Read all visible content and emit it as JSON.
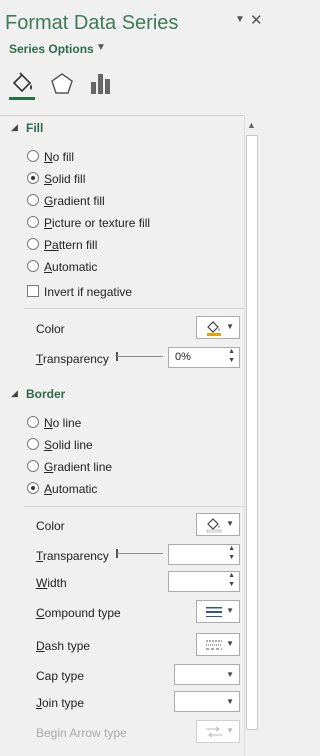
{
  "header": {
    "title": "Format Data Series",
    "series_options_label": "Series Options",
    "dropdown_icon": "caret-down-icon",
    "close_icon": "close-icon"
  },
  "tabs": [
    {
      "name": "fill-line-tab",
      "icon": "paint-bucket-icon",
      "active": true
    },
    {
      "name": "effects-tab",
      "icon": "pentagon-icon",
      "active": false
    },
    {
      "name": "series-options-tab",
      "icon": "bar-chart-icon",
      "active": false
    }
  ],
  "fill": {
    "heading": "Fill",
    "options": [
      {
        "key": "N",
        "rest": "o fill",
        "selected": false
      },
      {
        "key": "S",
        "rest": "olid fill",
        "selected": true
      },
      {
        "key": "G",
        "rest": "radient fill",
        "selected": false
      },
      {
        "key": "P",
        "rest": "icture or texture fill",
        "selected": false
      },
      {
        "key": "Pa",
        "rest": "ttern fill",
        "selected": false
      },
      {
        "key": "A",
        "rest": "utomatic",
        "selected": false
      }
    ],
    "invert_label": "Invert if negative",
    "color_label": "Color",
    "transparency_key": "T",
    "transparency_rest": "ransparency",
    "transparency_value": "0%"
  },
  "border": {
    "heading": "Border",
    "options": [
      {
        "key": "N",
        "rest": "o line",
        "selected": false
      },
      {
        "key": "S",
        "rest": "olid line",
        "selected": false
      },
      {
        "key": "G",
        "rest": "radient line",
        "selected": false
      },
      {
        "key": "A",
        "rest": "utomatic",
        "selected": true
      }
    ],
    "color_label": "Color",
    "transparency_key": "T",
    "transparency_rest": "ransparency",
    "transparency_value": "",
    "width_key": "W",
    "width_rest": "idth",
    "width_value": "",
    "compound_key": "C",
    "compound_rest": "ompound type",
    "dash_key": "D",
    "dash_rest": "ash type",
    "cap_key": "",
    "cap_label": "Cap type",
    "join_key": "J",
    "join_rest": "oin type",
    "begin_arrow_label": "Begin Arrow type"
  },
  "colors": {
    "accent": "#217346",
    "heading": "#2e6b4d",
    "fill_swatch": "#e8a200"
  }
}
